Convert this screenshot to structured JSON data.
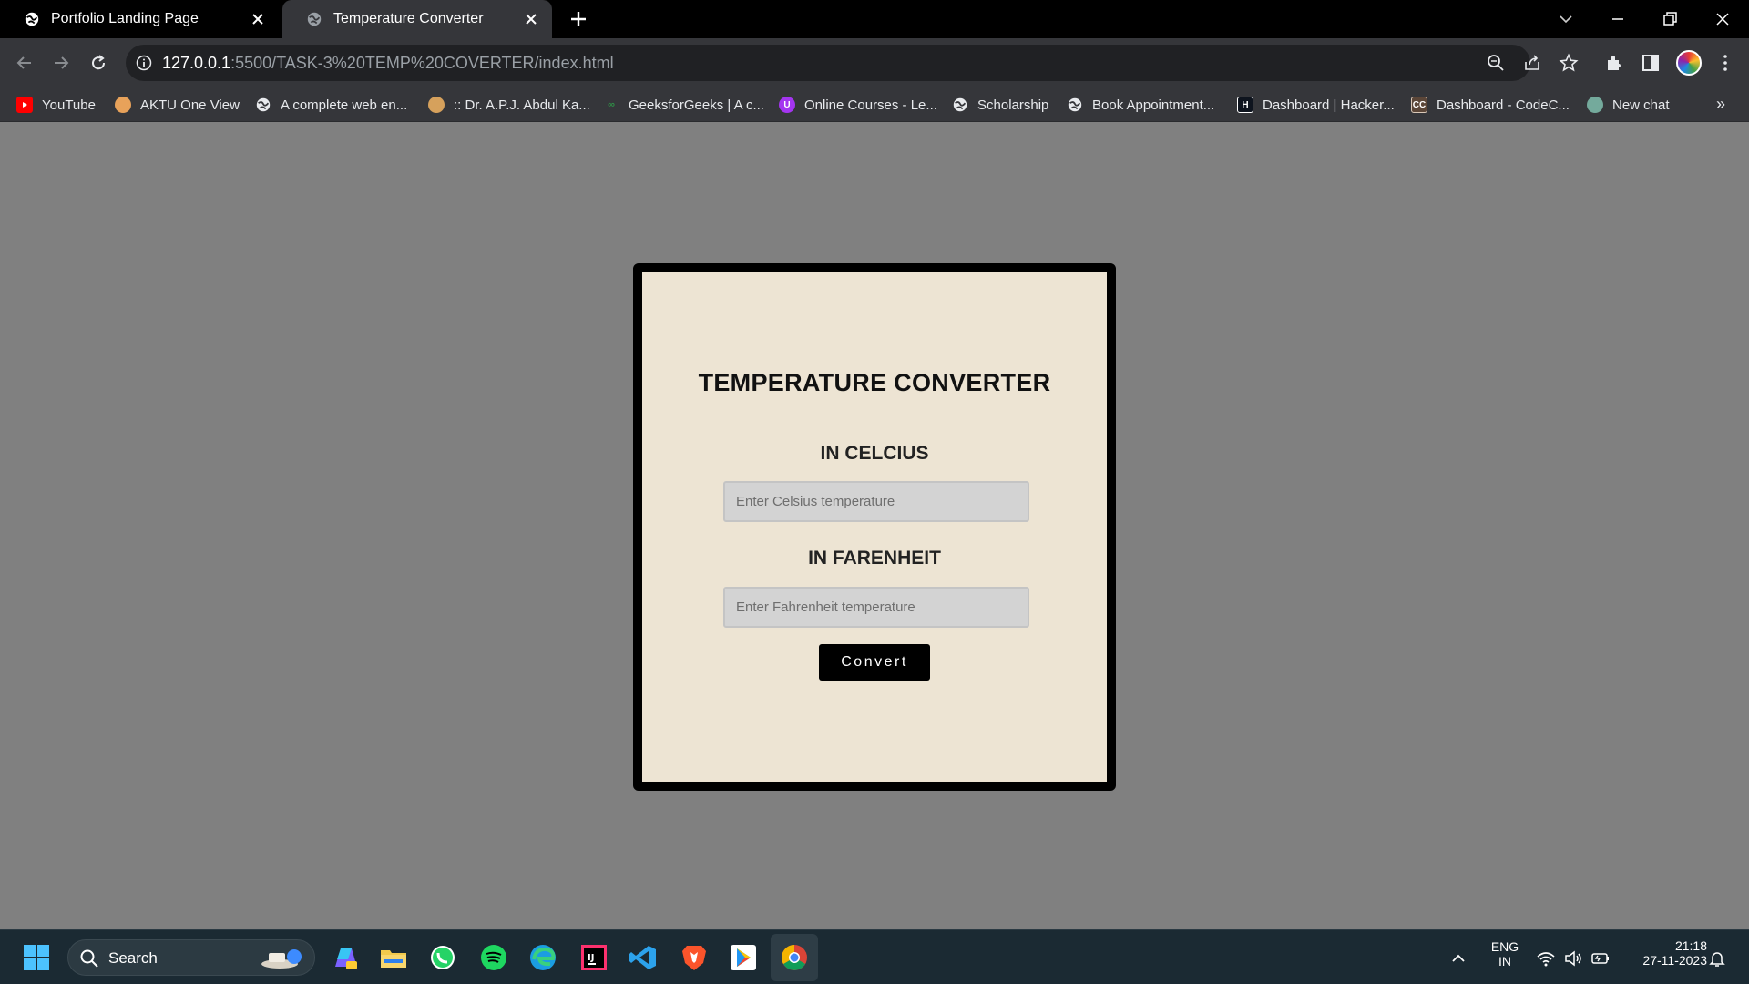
{
  "browser": {
    "tabs": [
      {
        "title": "Portfolio Landing Page",
        "active": false
      },
      {
        "title": "Temperature Converter",
        "active": true
      }
    ],
    "url_host": "127.0.0.1",
    "url_path": ":5500/TASK-3%20TEMP%20COVERTER/index.html",
    "bookmarks": [
      {
        "label": "YouTube",
        "icon": "youtube-icon"
      },
      {
        "label": "AKTU One View",
        "icon": "aktu-icon"
      },
      {
        "label": "A complete web en...",
        "icon": "globe-icon"
      },
      {
        "label": ":: Dr. A.P.J. Abdul Ka...",
        "icon": "aktu-icon"
      },
      {
        "label": "GeeksforGeeks | A c...",
        "icon": "gfg-icon"
      },
      {
        "label": "Online Courses - Le...",
        "icon": "udemy-icon"
      },
      {
        "label": "Scholarship",
        "icon": "globe-icon"
      },
      {
        "label": "Book Appointment...",
        "icon": "globe-icon"
      },
      {
        "label": "Dashboard | Hacker...",
        "icon": "hackerrank-icon"
      },
      {
        "label": "Dashboard - CodeC...",
        "icon": "codechef-icon"
      },
      {
        "label": "New chat",
        "icon": "chatgpt-icon"
      }
    ],
    "overflow": "»"
  },
  "app": {
    "title": "TEMPERATURE CONVERTER",
    "celsius_heading": "IN CELCIUS",
    "celsius_placeholder": "Enter Celsius temperature",
    "fahrenheit_heading": "IN FARENHEIT",
    "fahrenheit_placeholder": "Enter Fahrenheit temperature",
    "convert_label": "Convert"
  },
  "taskbar": {
    "search_label": "Search",
    "language": "ENG",
    "region": "IN",
    "time": "21:18",
    "date": "27-11-2023"
  },
  "colors": {
    "card_background": "#ede4d3",
    "page_background": "#808080",
    "button": "#000000"
  }
}
